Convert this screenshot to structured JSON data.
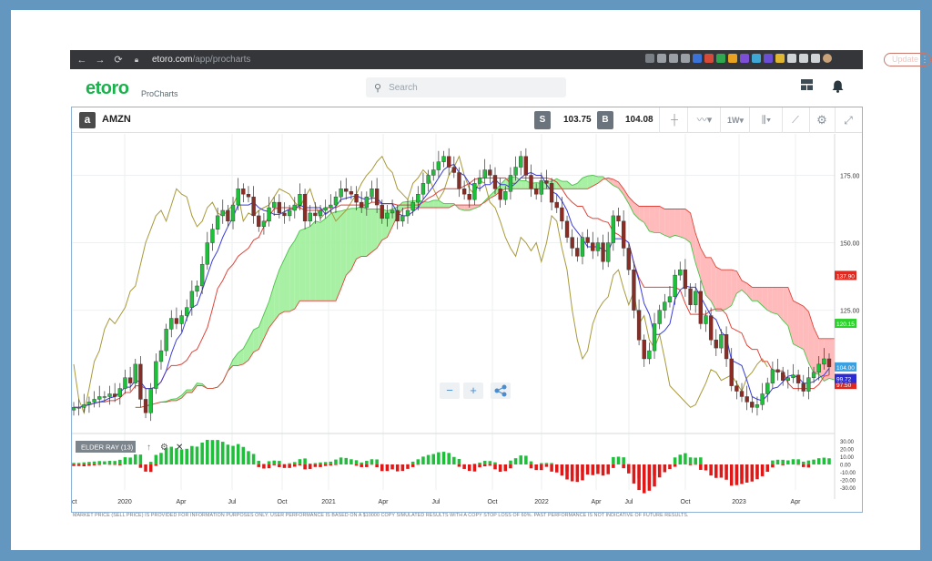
{
  "browser": {
    "url_host": "etoro.com",
    "url_path": "/app/procharts",
    "update_label": "Update"
  },
  "app": {
    "logo_text": "etoro",
    "product": "ProCharts",
    "search_placeholder": "Search"
  },
  "instrument": {
    "ticker": "AMZN",
    "sell_label": "S",
    "sell_price": "103.75",
    "buy_label": "B",
    "buy_price": "104.08",
    "interval": "1W"
  },
  "indicator": {
    "name": "ELDER RAY (13)"
  },
  "price_axis": {
    "ticks": [
      "175.00",
      "150.00",
      "125.00"
    ],
    "tags": {
      "cloud_top": "137.90",
      "cloud_bottom": "120.15",
      "last": "104.00",
      "blue": "99.72",
      "red": "97.50"
    }
  },
  "indicator_axis": {
    "ticks": [
      "30.00",
      "20.00",
      "10.00",
      "0.00",
      "-10.00",
      "-20.00",
      "-30.00"
    ]
  },
  "time_axis": {
    "labels": [
      "ct",
      "2020",
      "Apr",
      "Jul",
      "Oct",
      "2021",
      "Apr",
      "Jul",
      "Oct",
      "2022",
      "Apr",
      "Jul",
      "Oct",
      "2023",
      "Apr"
    ]
  },
  "zoom": {
    "minus": "−",
    "plus": "+"
  },
  "colors": {
    "up": "#1fbf3c",
    "down": "#8b2c24",
    "conversion": "#3a3ddc",
    "base": "#e0443a",
    "lagging": "#a89a3a",
    "cloud_bull": "#9ff09a",
    "cloud_bear": "#ffb4b4",
    "brand": "#19b34b"
  },
  "disclaimer": "MARKET PRICE (SELL PRICE) IS PROVIDED FOR INFORMATION PURPOSES ONLY. USER PERFORMANCE IS BASED ON A $10000 COPY SIMULATED RESULTS WITH A COPY STOP LOSS OF 60%. PAST PERFORMANCE IS NOT INDICATIVE OF FUTURE RESULTS.",
  "chart_data": {
    "type": "candlestick",
    "symbol": "AMZN",
    "interval": "1W",
    "ylim": [
      80,
      190
    ],
    "indicator_ylim": [
      -35,
      35
    ],
    "close": [
      89,
      89,
      90,
      91,
      92,
      93,
      93,
      94,
      93,
      96,
      100,
      98,
      105,
      92,
      87,
      96,
      106,
      110,
      118,
      122,
      120,
      123,
      126,
      132,
      134,
      142,
      150,
      155,
      160,
      162,
      158,
      164,
      170,
      168,
      167,
      160,
      156,
      158,
      163,
      165,
      161,
      160,
      162,
      164,
      168,
      158,
      161,
      160,
      162,
      163,
      164,
      167,
      170,
      169,
      168,
      165,
      163,
      167,
      170,
      164,
      159,
      161,
      162,
      158,
      160,
      162,
      165,
      168,
      172,
      175,
      177,
      180,
      182,
      178,
      176,
      170,
      168,
      166,
      172,
      174,
      177,
      175,
      170,
      166,
      169,
      175,
      178,
      182,
      175,
      170,
      168,
      173,
      172,
      165,
      163,
      158,
      152,
      148,
      145,
      152,
      150,
      147,
      150,
      143,
      150,
      160,
      158,
      148,
      140,
      125,
      114,
      107,
      110,
      120,
      125,
      128,
      130,
      138,
      140,
      133,
      127,
      132,
      120,
      123,
      114,
      111,
      116,
      107,
      97,
      95,
      93,
      91,
      89,
      90,
      94,
      98,
      103,
      102,
      99,
      100,
      101,
      98,
      95,
      100,
      102,
      105,
      107,
      104
    ]
  }
}
